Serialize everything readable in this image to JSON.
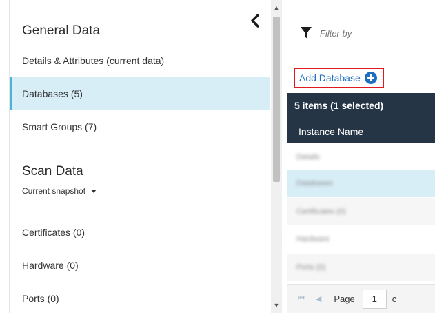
{
  "sidebar": {
    "general_title": "General Data",
    "items": [
      {
        "label": "Details & Attributes (current data)"
      },
      {
        "label": "Databases (5)"
      },
      {
        "label": "Smart Groups (7)"
      }
    ],
    "scan_title": "Scan Data",
    "snapshot_label": "Current snapshot",
    "scan_items": [
      {
        "label": "Certificates (0)"
      },
      {
        "label": "Hardware (0)"
      },
      {
        "label": "Ports (0)"
      }
    ]
  },
  "main": {
    "filter_placeholder": "Filter by",
    "add_button_label": "Add Database",
    "items_count": "5 items (1 selected)",
    "column_header": "Instance Name",
    "rows": [
      {
        "label": "Details"
      },
      {
        "label": "Databases"
      },
      {
        "label": "Certificates (0)"
      },
      {
        "label": "Hardware"
      },
      {
        "label": "Ports (0)"
      }
    ],
    "pager": {
      "page_label": "Page",
      "page_value": "1",
      "of_label": "c"
    }
  },
  "colors": {
    "accent": "#1f6fbf",
    "selected_row": "#d8eef7",
    "header_bg": "#263546",
    "highlight_border": "#e0191f"
  }
}
